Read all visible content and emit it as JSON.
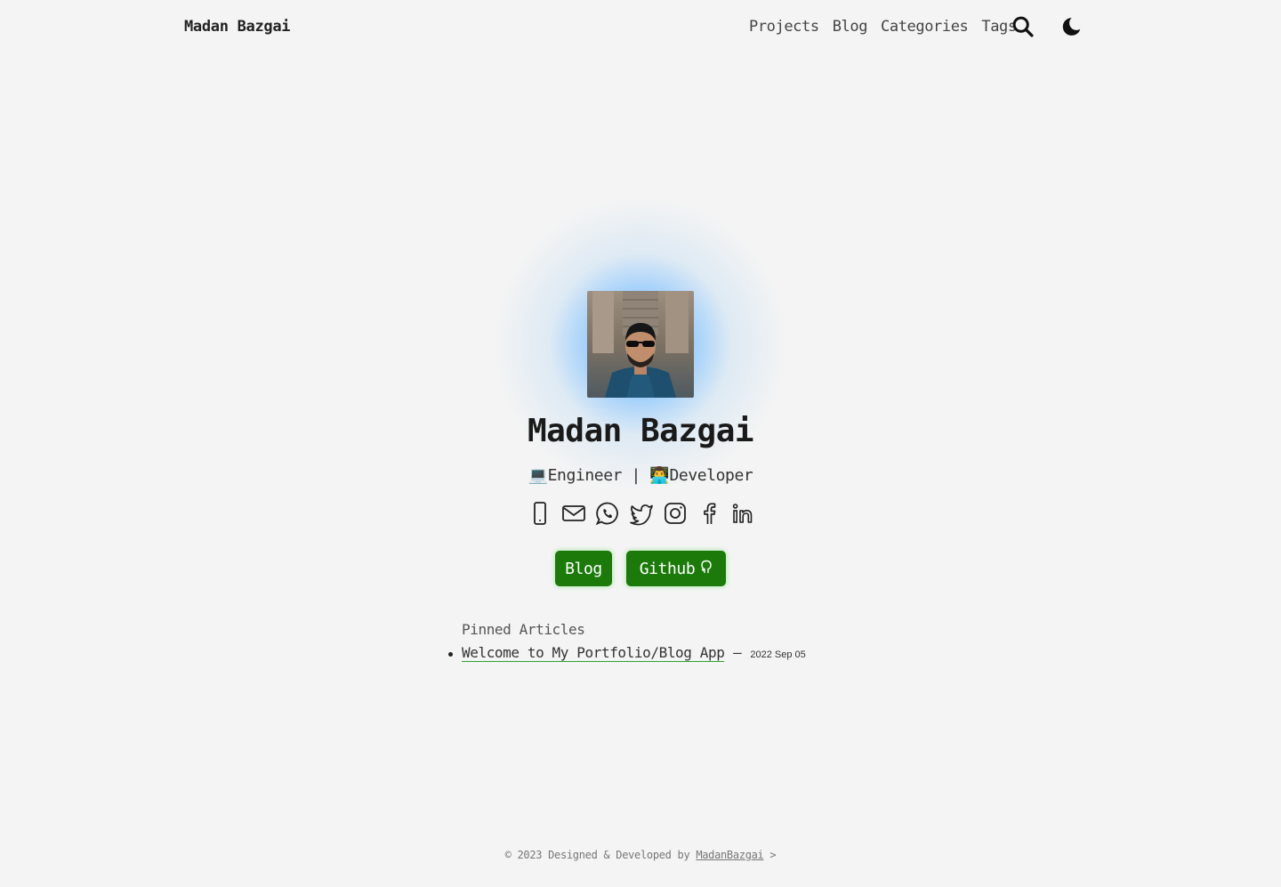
{
  "nav": {
    "brand": "Madan Bazgai",
    "links": [
      "Projects",
      "Blog",
      "Categories",
      "Tags"
    ],
    "icons": [
      "search-icon",
      "moon-icon"
    ]
  },
  "hero": {
    "name": "Madan Bazgai",
    "tagline": "💻Engineer | 👨‍💻Developer",
    "glow_color": "#42a0ff",
    "socials": [
      "phone-icon",
      "mail-icon",
      "whatsapp-icon",
      "twitter-icon",
      "instagram-icon",
      "facebook-icon",
      "linkedin-icon"
    ]
  },
  "buttons": {
    "blog_label": "Blog",
    "github_label": "Github",
    "bg_color": "#1b7a0a"
  },
  "pinned": {
    "heading": "Pinned Articles",
    "items": [
      {
        "title": "Welcome to My Portfolio/Blog App",
        "sep": " — ",
        "date": "2022 Sep 05"
      }
    ]
  },
  "footer": {
    "prefix": "© 2023  Designed & Developed by ",
    "author": "MadanBazgai",
    "suffix": " >"
  }
}
